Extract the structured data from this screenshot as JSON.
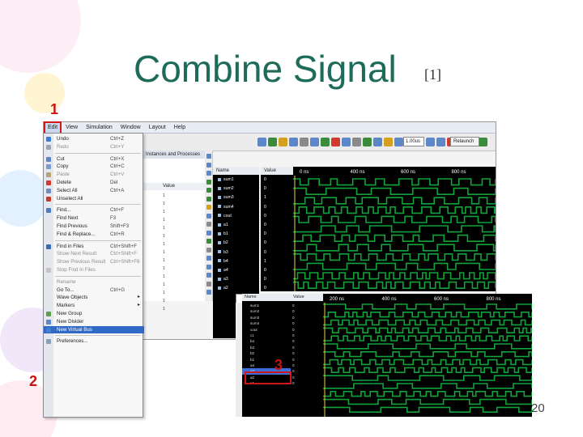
{
  "slide": {
    "title": "Combine Signal",
    "title_ref": "[1]",
    "slide_number": "20"
  },
  "steps": {
    "step1": "1",
    "step2": "2",
    "step3": "3"
  },
  "menubar": [
    "Edit",
    "View",
    "Simulation",
    "Window",
    "Layout",
    "Help"
  ],
  "edit_menu": [
    {
      "label": "Undo",
      "shortcut": "Ctrl+Z",
      "icon": "undo-icon",
      "color": "#3a7bd5"
    },
    {
      "label": "Redo",
      "shortcut": "Ctrl+Y",
      "icon": "redo-icon",
      "color": "#9aa3b2",
      "disabled": true
    },
    {
      "sep": true
    },
    {
      "label": "Cut",
      "shortcut": "Ctrl+X",
      "icon": "cut-icon",
      "color": "#5d87c9"
    },
    {
      "label": "Copy",
      "shortcut": "Ctrl+C",
      "icon": "copy-icon",
      "color": "#7a9bd0"
    },
    {
      "label": "Paste",
      "shortcut": "Ctrl+V",
      "icon": "paste-icon",
      "color": "#b9a277",
      "disabled": true
    },
    {
      "label": "Delete",
      "shortcut": "Del",
      "icon": "delete-icon",
      "color": "#d33a2f"
    },
    {
      "label": "Select All",
      "shortcut": "Ctrl+A",
      "icon": "select-all-icon",
      "color": "#6f8cc0"
    },
    {
      "label": "Unselect All",
      "shortcut": "",
      "icon": "unselect-all-icon",
      "color": "#c23b2e"
    },
    {
      "sep": true
    },
    {
      "label": "Find...",
      "shortcut": "Ctrl+F",
      "icon": "find-icon",
      "color": "#4d7ac4"
    },
    {
      "label": "Find Next",
      "shortcut": "F3",
      "icon": "",
      "color": ""
    },
    {
      "label": "Find Previous",
      "shortcut": "Shift+F3",
      "icon": "",
      "color": ""
    },
    {
      "label": "Find & Replace...",
      "shortcut": "Ctrl+R",
      "icon": "",
      "color": ""
    },
    {
      "sep": true
    },
    {
      "label": "Find in Files",
      "shortcut": "Ctrl+Shift+F",
      "icon": "find-in-files-icon",
      "color": "#3b6ab5"
    },
    {
      "label": "Show Next Result",
      "shortcut": "Ctrl+Shift+F",
      "icon": "",
      "color": "",
      "disabled": true
    },
    {
      "label": "Show Previous Result",
      "shortcut": "Ctrl+Shift+F8",
      "icon": "",
      "color": "",
      "disabled": true
    },
    {
      "label": "Stop Find in Files",
      "shortcut": "",
      "icon": "stop-icon",
      "color": "#c4c4c4",
      "disabled": true
    },
    {
      "sep": true
    },
    {
      "label": "Rename",
      "shortcut": "",
      "icon": "",
      "color": "",
      "disabled": true
    },
    {
      "label": "Go To...",
      "shortcut": "Ctrl+G",
      "icon": "",
      "color": ""
    },
    {
      "label": "Wave Objects",
      "shortcut": "",
      "icon": "",
      "color": "",
      "submenu": true
    },
    {
      "label": "Markers",
      "shortcut": "",
      "icon": "",
      "color": "",
      "submenu": true
    },
    {
      "label": "New Group",
      "shortcut": "",
      "icon": "new-group-icon",
      "color": "#5d9c4a"
    },
    {
      "label": "New Divider",
      "shortcut": "",
      "icon": "new-divider-icon",
      "color": "#5d87c9"
    },
    {
      "label": "New Virtual Bus",
      "shortcut": "",
      "icon": "new-virtual-bus-icon",
      "color": "#3f7fd0",
      "highlighted": true
    },
    {
      "sep": true
    },
    {
      "label": "Preferences...",
      "shortcut": "",
      "icon": "preferences-icon",
      "color": "#8aa0b8"
    }
  ],
  "objects_panel": {
    "header": "Instances and Processes",
    "col_header": "Value",
    "rows": [
      "1",
      "1",
      "1",
      "1",
      "1",
      "1",
      "1",
      "1",
      "1",
      "1",
      "1",
      "1",
      "1",
      "1",
      "1"
    ]
  },
  "wave_window": {
    "name_header": "Name",
    "value_header": "Value",
    "signals": [
      {
        "name": "sum1",
        "value": "0"
      },
      {
        "name": "sum2",
        "value": "0"
      },
      {
        "name": "sum3",
        "value": "1"
      },
      {
        "name": "sum4",
        "value": "0"
      },
      {
        "name": "cout",
        "value": "0"
      },
      {
        "name": "a1",
        "value": "0"
      },
      {
        "name": "b1",
        "value": "0"
      },
      {
        "name": "b2",
        "value": "0"
      },
      {
        "name": "b3",
        "value": "0"
      },
      {
        "name": "b4",
        "value": "1"
      },
      {
        "name": "a4",
        "value": "0"
      },
      {
        "name": "a3",
        "value": "0"
      },
      {
        "name": "a2",
        "value": "0"
      }
    ],
    "time_labels": [
      "0 ns",
      "400 ns",
      "600 ns",
      "800 ns"
    ],
    "zoom": "1.00us",
    "relaunch": "Relaunch",
    "wave_color": "#0fa33a"
  },
  "wave_window_2": {
    "name_header": "Name",
    "value_header": "Value",
    "signals": [
      "sum1",
      "sum2",
      "sum3",
      "sum4",
      "cout",
      "c1",
      "b4",
      "b3",
      "b2",
      "b1",
      "a4",
      "a3",
      "a2",
      "a1"
    ],
    "selected_index": 11,
    "time_labels": [
      "200 ns",
      "400 ns",
      "600 ns",
      "800 ns"
    ]
  }
}
